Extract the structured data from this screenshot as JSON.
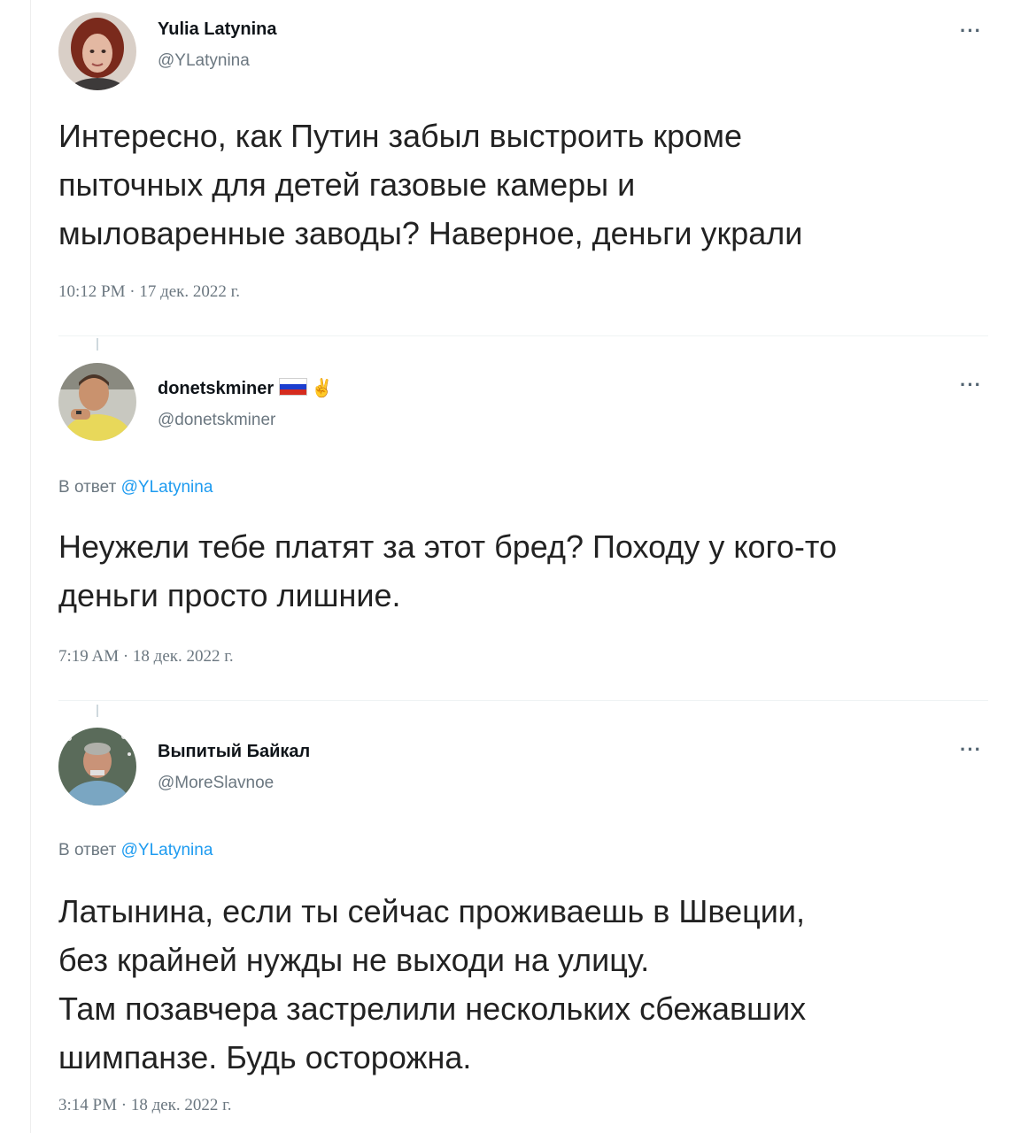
{
  "tweets": [
    {
      "name": "Yulia Latynina",
      "handle": "@YLatynina",
      "more": "···",
      "text": "Интересно, как Путин забыл выстроить кроме\nпыточных для детей газовые камеры и\nмыловаренные заводы? Наверное, деньги украли",
      "time": "10:12 PM · 17 дек. 2022 г."
    },
    {
      "name": "donetskminer",
      "handle": "@donetskminer",
      "more": "···",
      "badge_icon": "victory-hand-icon",
      "flag_colors": [
        "#ffffff",
        "#1c3ecf",
        "#d52b1e"
      ],
      "reply_prefix": "В ответ",
      "reply_mention": "@YLatynina",
      "text": "Неужели тебе платят за этот бред? Походу у кого-то\nденьги просто лишние.",
      "time": "7:19 AM · 18 дек. 2022 г."
    },
    {
      "name": "Выпитый Байкал",
      "handle": "@MoreSlavnoe",
      "more": "···",
      "reply_prefix": "В ответ",
      "reply_mention": "@YLatynina",
      "text": "Латынина, если ты сейчас проживаешь в Швеции,\nбез крайней нужды не выходи на улицу.\nТам позавчера застрелили нескольких сбежавших\nшимпанзе. Будь осторожна.",
      "time": "3:14 PM · 18 дек. 2022 г."
    }
  ],
  "colors": {
    "accent": "#1d9bf0",
    "secondary_text": "#6b7780"
  }
}
